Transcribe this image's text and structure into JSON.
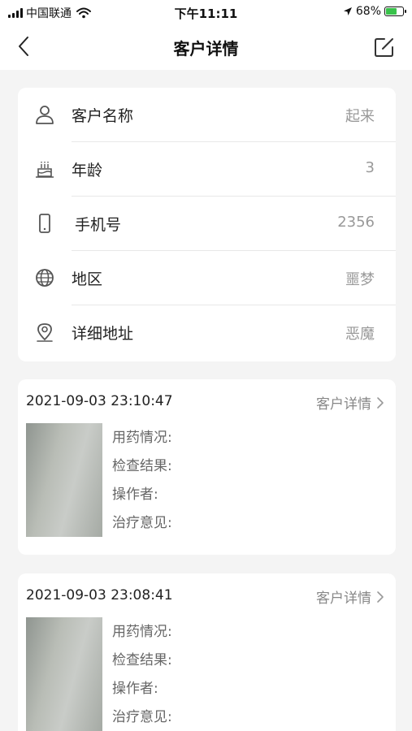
{
  "status_bar": {
    "carrier": "中国联通",
    "time": "下午11:11",
    "battery_percent": "68%",
    "battery_level": 0.68
  },
  "nav": {
    "title": "客户详情"
  },
  "customer_info": [
    {
      "icon": "user-icon",
      "label": "客户名称",
      "value": "起来"
    },
    {
      "icon": "birthday-cake-icon",
      "label": "年龄",
      "value": "3"
    },
    {
      "icon": "phone-icon",
      "label": "手机号",
      "value": "2356"
    },
    {
      "icon": "globe-icon",
      "label": "地区",
      "value": "噩梦"
    },
    {
      "icon": "location-pin-icon",
      "label": "详细地址",
      "value": "恶魔"
    }
  ],
  "records": [
    {
      "timestamp": "2021-09-03 23:10:47",
      "link_label": "客户详情",
      "fields": [
        "用药情况:",
        "检查结果:",
        "操作者:",
        "治疗意见:"
      ]
    },
    {
      "timestamp": "2021-09-03 23:08:41",
      "link_label": "客户详情",
      "fields": [
        "用药情况:",
        "检查结果:",
        "操作者:",
        "治疗意见:"
      ]
    }
  ]
}
